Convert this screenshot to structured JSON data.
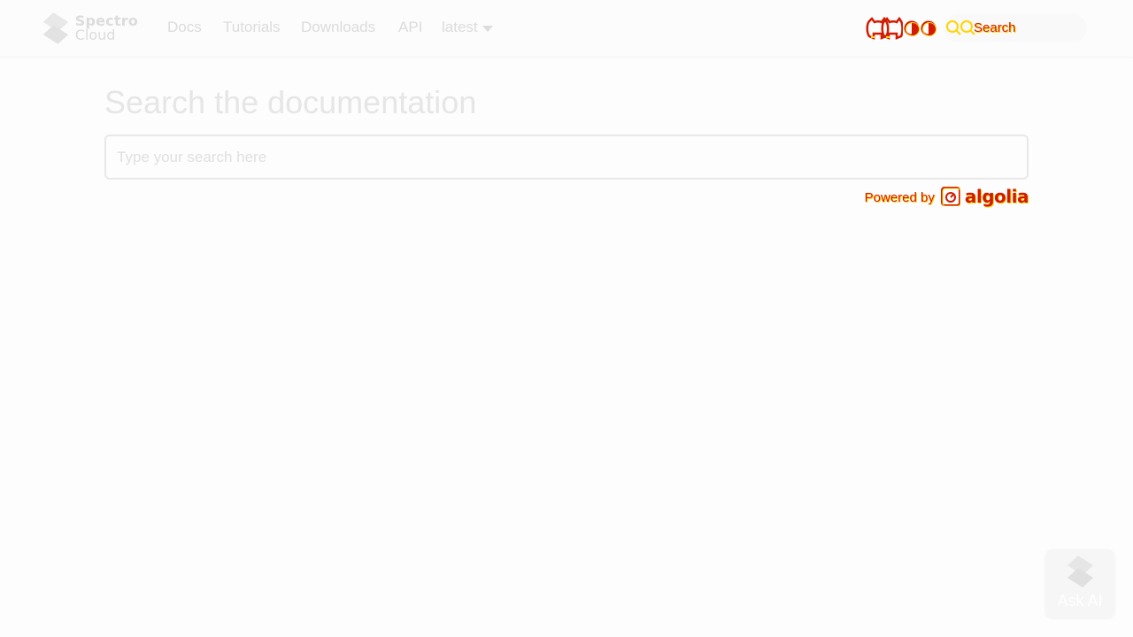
{
  "navbar": {
    "logo": {
      "line1": "Spectro",
      "line2": "Cloud",
      "icon": "spectro-cloud-logo-icon"
    },
    "links": [
      "Docs",
      "Tutorials",
      "Downloads",
      "API"
    ],
    "version": {
      "selected": "latest",
      "icon": "chevron-down-icon"
    },
    "github_icon": "github-icon",
    "theme_icon": "theme-toggle-icon",
    "search": {
      "label": "Search",
      "icon": "search-icon"
    }
  },
  "main": {
    "title": "Search the documentation",
    "search_input": {
      "placeholder": "Type your search here",
      "value": ""
    },
    "powered_by": {
      "text": "Powered by",
      "brand": "algolia"
    }
  },
  "ask_ai": {
    "label": "Ask AI",
    "icon": "spectro-cloud-logo-icon"
  },
  "colors": {
    "artifact_red": "#d21b00",
    "artifact_yellow": "#ffd400",
    "muted_text": "#dcdcdc"
  }
}
